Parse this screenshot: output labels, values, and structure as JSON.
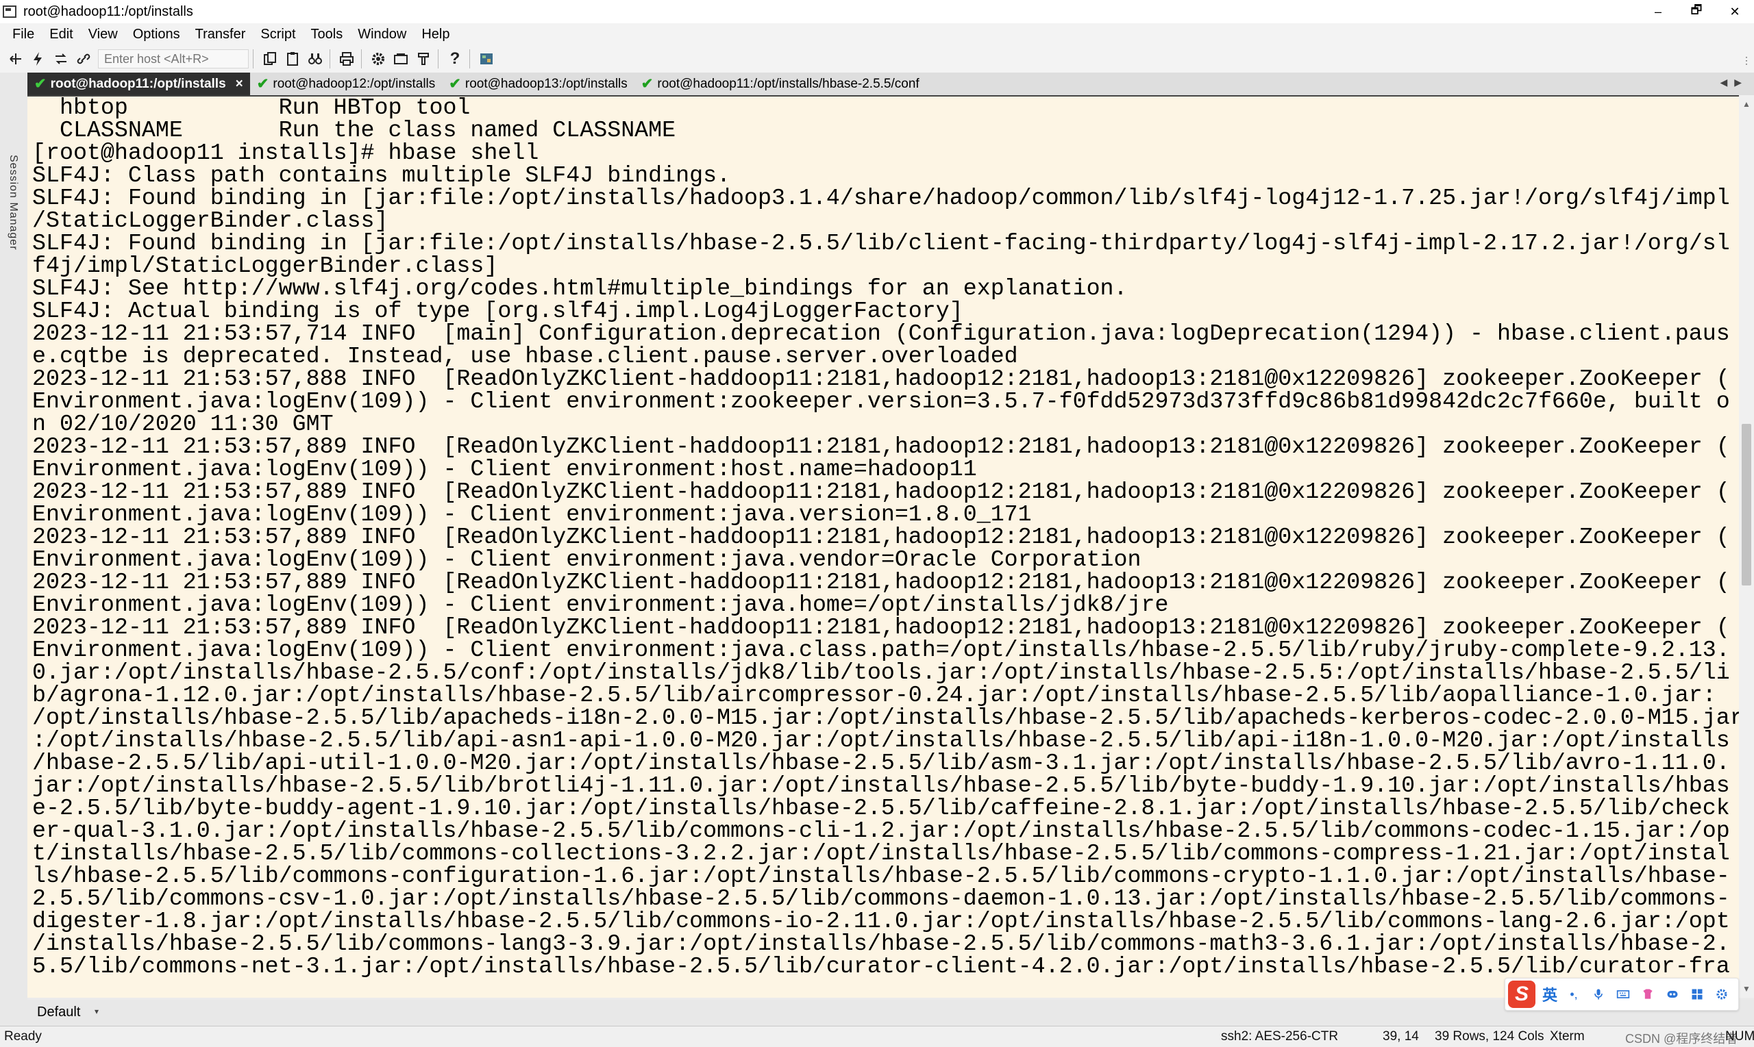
{
  "window": {
    "title": "root@hadoop11:/opt/installs",
    "controls": [
      "–",
      "🗗",
      "✕"
    ]
  },
  "menu": [
    "File",
    "Edit",
    "View",
    "Options",
    "Transfer",
    "Script",
    "Tools",
    "Window",
    "Help"
  ],
  "toolbar": {
    "host_placeholder": "Enter host <Alt+R>",
    "icons": [
      "connect-icon",
      "quick-connect-icon",
      "reconnect-icon",
      "disconnect-icon",
      "copy-icon",
      "paste-icon",
      "find-icon",
      "print-icon",
      "settings-icon",
      "sftp-icon",
      "keymap-icon",
      "help-icon",
      "map-icon"
    ]
  },
  "session_manager": {
    "label": "Session Manager"
  },
  "tabs": [
    {
      "label": "root@hadoop11:/opt/installs",
      "active": true,
      "close": "×"
    },
    {
      "label": "root@hadoop12:/opt/installs",
      "active": false
    },
    {
      "label": "root@hadoop13:/opt/installs",
      "active": false
    },
    {
      "label": "root@hadoop11:/opt/installs/hbase-2.5.5/conf",
      "active": false
    }
  ],
  "terminal": {
    "lines": [
      "  hbtop           Run HBTop tool",
      "  CLASSNAME       Run the class named CLASSNAME",
      "[root@hadoop11 installs]# hbase shell",
      "SLF4J: Class path contains multiple SLF4J bindings.",
      "SLF4J: Found binding in [jar:file:/opt/installs/hadoop3.1.4/share/hadoop/common/lib/slf4j-log4j12-1.7.25.jar!/org/slf4j/impl",
      "/StaticLoggerBinder.class]",
      "SLF4J: Found binding in [jar:file:/opt/installs/hbase-2.5.5/lib/client-facing-thirdparty/log4j-slf4j-impl-2.17.2.jar!/org/sl",
      "f4j/impl/StaticLoggerBinder.class]",
      "SLF4J: See http://www.slf4j.org/codes.html#multiple_bindings for an explanation.",
      "SLF4J: Actual binding is of type [org.slf4j.impl.Log4jLoggerFactory]",
      "2023-12-11 21:53:57,714 INFO  [main] Configuration.deprecation (Configuration.java:logDeprecation(1294)) - hbase.client.paus",
      "e.cqtbe is deprecated. Instead, use hbase.client.pause.server.overloaded",
      "2023-12-11 21:53:57,888 INFO  [ReadOnlyZKClient-haddoop11:2181,hadoop12:2181,hadoop13:2181@0x12209826] zookeeper.ZooKeeper (",
      "Environment.java:logEnv(109)) - Client environment:zookeeper.version=3.5.7-f0fdd52973d373ffd9c86b81d99842dc2c7f660e, built o",
      "n 02/10/2020 11:30 GMT",
      "2023-12-11 21:53:57,889 INFO  [ReadOnlyZKClient-haddoop11:2181,hadoop12:2181,hadoop13:2181@0x12209826] zookeeper.ZooKeeper (",
      "Environment.java:logEnv(109)) - Client environment:host.name=hadoop11",
      "2023-12-11 21:53:57,889 INFO  [ReadOnlyZKClient-haddoop11:2181,hadoop12:2181,hadoop13:2181@0x12209826] zookeeper.ZooKeeper (",
      "Environment.java:logEnv(109)) - Client environment:java.version=1.8.0_171",
      "2023-12-11 21:53:57,889 INFO  [ReadOnlyZKClient-haddoop11:2181,hadoop12:2181,hadoop13:2181@0x12209826] zookeeper.ZooKeeper (",
      "Environment.java:logEnv(109)) - Client environment:java.vendor=Oracle Corporation",
      "2023-12-11 21:53:57,889 INFO  [ReadOnlyZKClient-haddoop11:2181,hadoop12:2181,hadoop13:2181@0x12209826] zookeeper.ZooKeeper (",
      "Environment.java:logEnv(109)) - Client environment:java.home=/opt/installs/jdk8/jre",
      "2023-12-11 21:53:57,889 INFO  [ReadOnlyZKClient-haddoop11:2181,hadoop12:2181,hadoop13:2181@0x12209826] zookeeper.ZooKeeper (",
      "Environment.java:logEnv(109)) - Client environment:java.class.path=/opt/installs/hbase-2.5.5/lib/ruby/jruby-complete-9.2.13.",
      "0.jar:/opt/installs/hbase-2.5.5/conf:/opt/installs/jdk8/lib/tools.jar:/opt/installs/hbase-2.5.5:/opt/installs/hbase-2.5.5/li",
      "b/agrona-1.12.0.jar:/opt/installs/hbase-2.5.5/lib/aircompressor-0.24.jar:/opt/installs/hbase-2.5.5/lib/aopalliance-1.0.jar:",
      "/opt/installs/hbase-2.5.5/lib/apacheds-i18n-2.0.0-M15.jar:/opt/installs/hbase-2.5.5/lib/apacheds-kerberos-codec-2.0.0-M15.jar",
      ":/opt/installs/hbase-2.5.5/lib/api-asn1-api-1.0.0-M20.jar:/opt/installs/hbase-2.5.5/lib/api-i18n-1.0.0-M20.jar:/opt/installs",
      "/hbase-2.5.5/lib/api-util-1.0.0-M20.jar:/opt/installs/hbase-2.5.5/lib/asm-3.1.jar:/opt/installs/hbase-2.5.5/lib/avro-1.11.0.",
      "jar:/opt/installs/hbase-2.5.5/lib/brotli4j-1.11.0.jar:/opt/installs/hbase-2.5.5/lib/byte-buddy-1.9.10.jar:/opt/installs/hbas",
      "e-2.5.5/lib/byte-buddy-agent-1.9.10.jar:/opt/installs/hbase-2.5.5/lib/caffeine-2.8.1.jar:/opt/installs/hbase-2.5.5/lib/check",
      "er-qual-3.1.0.jar:/opt/installs/hbase-2.5.5/lib/commons-cli-1.2.jar:/opt/installs/hbase-2.5.5/lib/commons-codec-1.15.jar:/op",
      "t/installs/hbase-2.5.5/lib/commons-collections-3.2.2.jar:/opt/installs/hbase-2.5.5/lib/commons-compress-1.21.jar:/opt/instal",
      "ls/hbase-2.5.5/lib/commons-configuration-1.6.jar:/opt/installs/hbase-2.5.5/lib/commons-crypto-1.1.0.jar:/opt/installs/hbase-",
      "2.5.5/lib/commons-csv-1.0.jar:/opt/installs/hbase-2.5.5/lib/commons-daemon-1.0.13.jar:/opt/installs/hbase-2.5.5/lib/commons-",
      "digester-1.8.jar:/opt/installs/hbase-2.5.5/lib/commons-io-2.11.0.jar:/opt/installs/hbase-2.5.5/lib/commons-lang-2.6.jar:/opt",
      "/installs/hbase-2.5.5/lib/commons-lang3-3.9.jar:/opt/installs/hbase-2.5.5/lib/commons-math3-3.6.1.jar:/opt/installs/hbase-2.",
      "5.5/lib/commons-net-3.1.jar:/opt/installs/hbase-2.5.5/lib/curator-client-4.2.0.jar:/opt/installs/hbase-2.5.5/lib/curator-fra"
    ]
  },
  "bottom": {
    "default_label": "Default",
    "caret": "▾"
  },
  "ime": {
    "lang": "英",
    "punct": "•,",
    "logo": "S"
  },
  "status": {
    "ready": "Ready",
    "cipher": "ssh2: AES-256-CTR",
    "cursor": "39, 14",
    "size": "39 Rows, 124 Cols",
    "term": "Xterm",
    "watermark": "CSDN @程序终结者",
    "num": "NUM"
  },
  "colors": {
    "terminal_bg": "#fdf5e4",
    "active_tab_bg": "#2f2f2f",
    "check_green": "#1fa01f"
  }
}
